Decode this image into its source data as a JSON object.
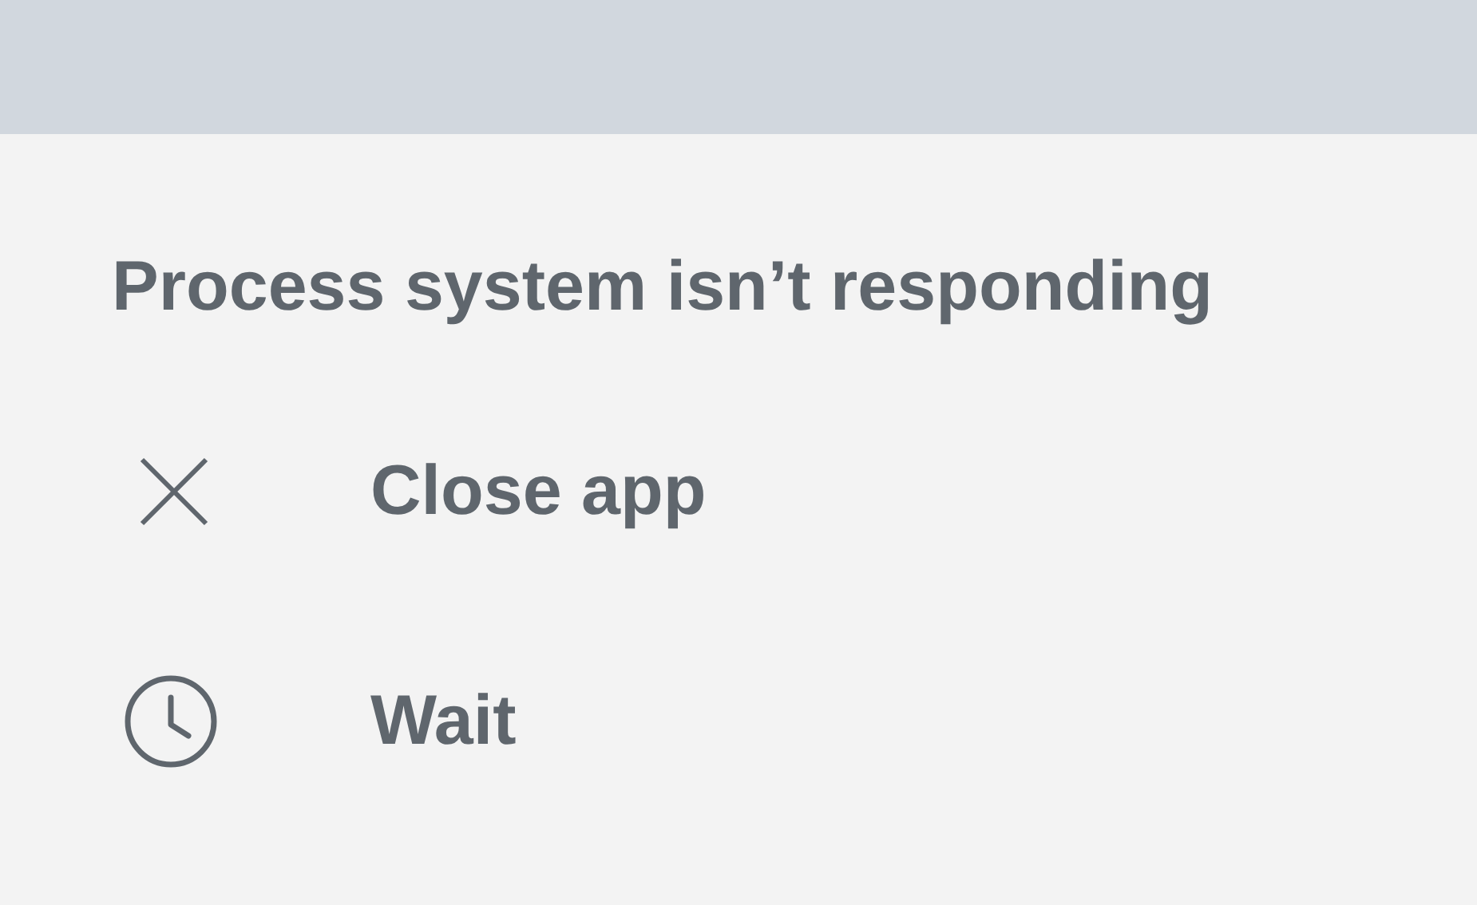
{
  "title": "Process system isn’t responding",
  "actions": [
    {
      "kind": "close",
      "label": "Close app"
    },
    {
      "kind": "wait",
      "label": "Wait"
    }
  ]
}
